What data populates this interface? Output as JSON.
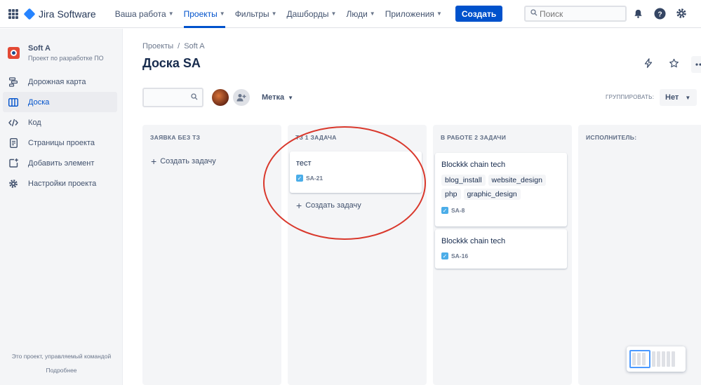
{
  "topnav": {
    "logo_text": "Jira Software",
    "items": [
      {
        "label": "Ваша работа",
        "dropdown": true,
        "active": false
      },
      {
        "label": "Проекты",
        "dropdown": true,
        "active": true
      },
      {
        "label": "Фильтры",
        "dropdown": true,
        "active": false
      },
      {
        "label": "Дашборды",
        "dropdown": true,
        "active": false
      },
      {
        "label": "Люди",
        "dropdown": true,
        "active": false
      },
      {
        "label": "Приложения",
        "dropdown": true,
        "active": false
      }
    ],
    "create_label": "Создать",
    "search_placeholder": "Поиск",
    "icons": [
      "notifications-icon",
      "help-icon",
      "settings-icon"
    ]
  },
  "sidebar": {
    "project_name": "Soft A",
    "project_desc": "Проект по разработке ПО",
    "items": [
      {
        "label": "Дорожная карта",
        "icon": "roadmap-icon",
        "active": false
      },
      {
        "label": "Доска",
        "icon": "board-icon",
        "active": true
      },
      {
        "label": "Код",
        "icon": "code-icon",
        "active": false
      },
      {
        "label": "Страницы проекта",
        "icon": "pages-icon",
        "active": false
      },
      {
        "label": "Добавить элемент",
        "icon": "add-item-icon",
        "active": false
      },
      {
        "label": "Настройки проекта",
        "icon": "settings-icon",
        "active": false
      }
    ],
    "footer_text": "Это проект, управляемый командой",
    "footer_link": "Подробнее"
  },
  "main": {
    "breadcrumb": [
      "Проекты",
      "Soft A"
    ],
    "title": "Доска SA",
    "filter": {
      "label_filter": "Метка",
      "group_by_label": "ГРУППИРОВАТЬ:",
      "group_by_value": "Нет"
    },
    "columns": [
      {
        "title": "ЗАЯВКА БЕЗ ТЗ",
        "create_label": "Создать задачу",
        "cards": []
      },
      {
        "title": "ТЗ 1 ЗАДАЧА",
        "create_label": "Создать задачу",
        "cards": [
          {
            "title": "тест",
            "labels": [],
            "key": "SA-21"
          }
        ]
      },
      {
        "title": "В РАБОТЕ 2 ЗАДАЧИ",
        "cards": [
          {
            "title": "Blockkk chain tech",
            "labels": [
              "blog_install",
              "website_design",
              "php",
              "graphic_design"
            ],
            "key": "SA-8"
          },
          {
            "title": "Blockkk chain tech",
            "labels": [],
            "key": "SA-16"
          }
        ]
      },
      {
        "title": "ИСПОЛНИТЕЛЬ:",
        "cards": []
      }
    ]
  },
  "colors": {
    "brand": "#0052cc",
    "annotation_circle": "#d9382c",
    "story_checkbox": "#4bade8"
  }
}
